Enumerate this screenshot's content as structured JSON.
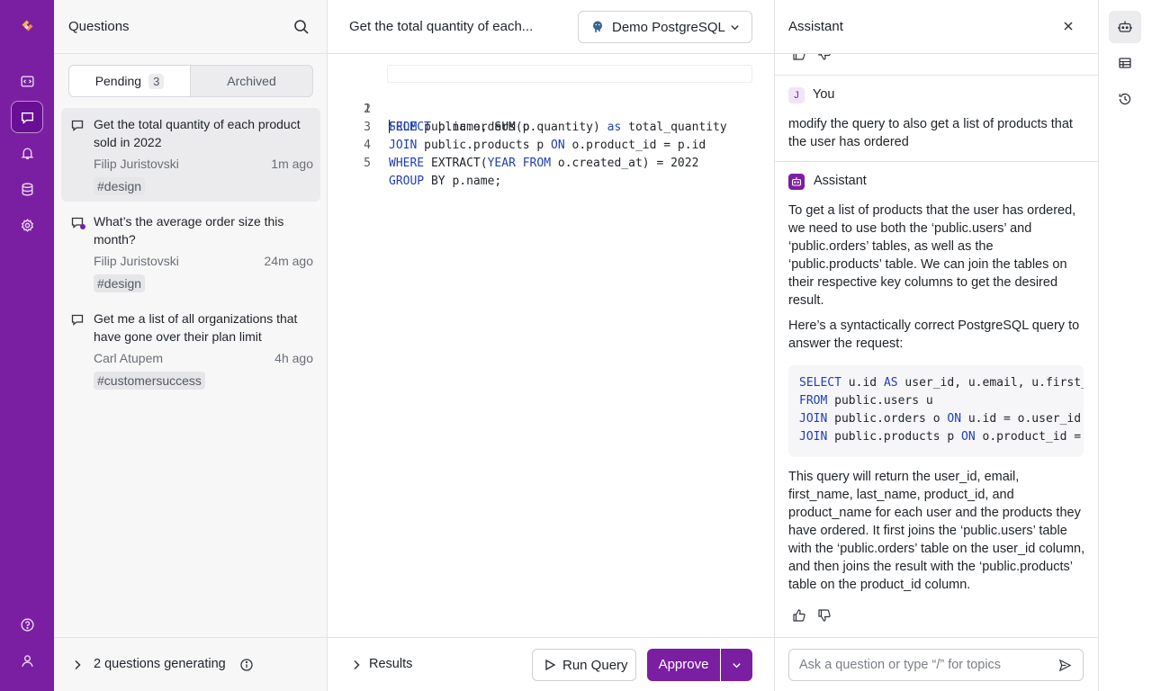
{
  "nav": {
    "items": [
      "sql-icon",
      "chat-icon",
      "bell-icon",
      "database-icon",
      "settings-icon"
    ],
    "bottom": [
      "help-icon",
      "user-icon"
    ]
  },
  "questions": {
    "title": "Questions",
    "tabs": {
      "pending_label": "Pending",
      "pending_count": "3",
      "archived_label": "Archived"
    },
    "items": [
      {
        "text": "Get the total quantity of each product sold in 2022",
        "author": "Filip Juristovski",
        "time": "1m ago",
        "tag": "#design"
      },
      {
        "text": "What’s the average order size this month?",
        "author": "Filip Juristovski",
        "time": "24m ago",
        "tag": "#design"
      },
      {
        "text": "Get me a list of all organizations that have gone over their plan limit",
        "author": "Carl Atupem",
        "time": "4h ago",
        "tag": "#customersuccess"
      }
    ],
    "generating": "2 questions generating"
  },
  "editor": {
    "title": "Get the total quantity of each...",
    "database": "Demo PostgreSQL",
    "line_numbers": [
      "1",
      "2",
      "3",
      "4",
      "5"
    ],
    "code": [
      [
        {
          "t": "SELECT",
          "k": true
        },
        {
          "t": " p.name, SUM(p.quantity) "
        },
        {
          "t": "as",
          "k": true
        },
        {
          "t": " total_quantity"
        }
      ],
      [
        {
          "t": "FROM",
          "k": true
        },
        {
          "t": " public.orders o"
        }
      ],
      [
        {
          "t": "JOIN",
          "k": true
        },
        {
          "t": " public.products p "
        },
        {
          "t": "ON",
          "k": true
        },
        {
          "t": " o.product_id = p.id"
        }
      ],
      [
        {
          "t": "WHERE",
          "k": true
        },
        {
          "t": " EXTRACT("
        },
        {
          "t": "YEAR",
          "k": true
        },
        {
          "t": " "
        },
        {
          "t": "FROM",
          "k": true
        },
        {
          "t": " o.created_at) = 2022"
        }
      ],
      [
        {
          "t": "GROUP",
          "k": true
        },
        {
          "t": " BY p.name;"
        }
      ]
    ],
    "results_label": "Results",
    "run_label": "Run Query",
    "approve_label": "Approve"
  },
  "assistant": {
    "title": "Assistant",
    "user_initial": "J",
    "user_name": "You",
    "user_message": "modify the query to also get a list of products that the user has ordered",
    "bot_name": "Assistant",
    "reply_p1": "To get a list of products that the user has ordered, we need to use both the ‘public.users’ and ‘public.orders’ tables, as well as the ‘public.products’ table. We can join the tables on their respective key columns to get the desired result.",
    "reply_p2": "Here’s a syntactically correct PostgreSQL query to answer the request:",
    "reply_code": [
      [
        {
          "t": "SELECT",
          "k": true
        },
        {
          "t": " u.id "
        },
        {
          "t": "AS",
          "k": true
        },
        {
          "t": " user_id, u.email, u.first_"
        }
      ],
      [
        {
          "t": "FROM",
          "k": true
        },
        {
          "t": " public.users u"
        }
      ],
      [
        {
          "t": "JOIN",
          "k": true
        },
        {
          "t": " public.orders o "
        },
        {
          "t": "ON",
          "k": true
        },
        {
          "t": " u.id = o.user_id"
        }
      ],
      [
        {
          "t": "JOIN",
          "k": true
        },
        {
          "t": " public.products p "
        },
        {
          "t": "ON",
          "k": true
        },
        {
          "t": " o.product_id ="
        }
      ]
    ],
    "reply_p3": "This query will return the user_id, email, first_name, last_name, product_id, and product_name for each user and the products they have ordered. It first joins the ‘public.users’ table with the ‘public.orders’ table on the user_id column, and then joins the result with the ‘public.products’ table on the product_id column.",
    "input_placeholder": "Ask a question or type “/” for topics"
  },
  "toolrail": [
    "assistant-icon",
    "table-icon",
    "history-icon"
  ],
  "colors": {
    "brand": "#7b1fa2",
    "keyword": "#1f3fb5"
  }
}
